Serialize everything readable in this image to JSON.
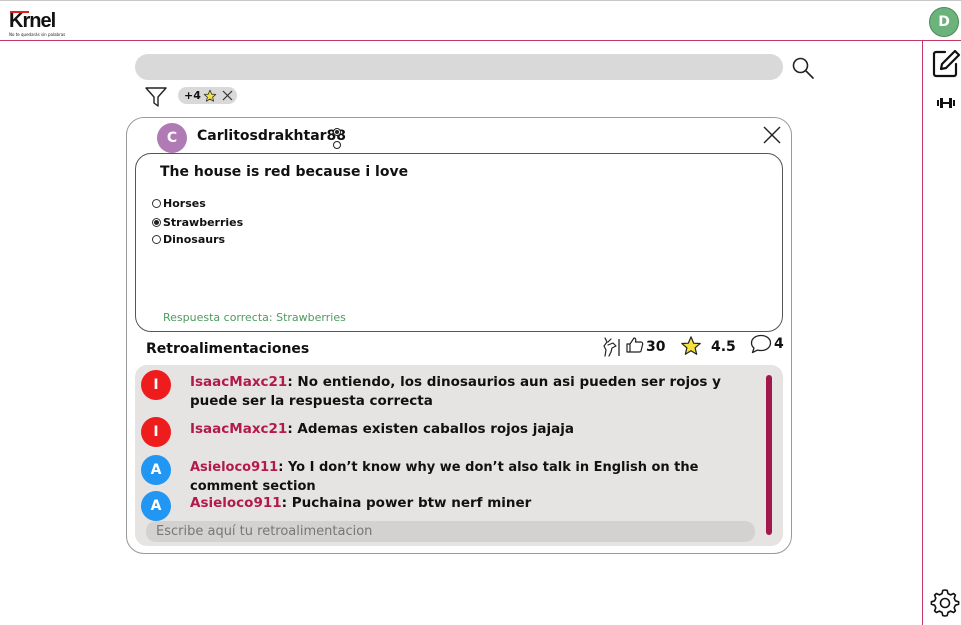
{
  "app": {
    "logo": "Krnel",
    "tagline": "No te quedarás sin palabras",
    "user_initial": "D"
  },
  "search": {
    "placeholder": "",
    "value": ""
  },
  "filter": {
    "chip_label": "+4",
    "chip_icon": "star-icon",
    "chip_remove_icon": "close-icon"
  },
  "post": {
    "author_initial": "C",
    "author": "Carlitosdrakhtar88",
    "question": "The house is red because i love",
    "options": [
      {
        "label": "Horses",
        "selected": false
      },
      {
        "label": "Strawberries",
        "selected": true
      },
      {
        "label": "Dinosaurs",
        "selected": false
      }
    ],
    "answer_text": "Respuesta correcta: Strawberries",
    "feedback_title": "Retroalimentaciones",
    "likes": "30",
    "rating": "4.5",
    "comments_count": "4"
  },
  "comments": [
    {
      "initial": "I",
      "user": "IsaacMaxc21",
      "text": ": No entiendo, los dinosaurios aun asi pueden ser rojos y puede ser la respuesta correcta",
      "color": "#ee1c1c"
    },
    {
      "initial": "I",
      "user": "IsaacMaxc21",
      "text": ": Ademas existen caballos rojos jajaja",
      "color": "#ee1c1c"
    },
    {
      "initial": "A",
      "user": "Asieloco911",
      "text": ": Yo I don’t know why we don’t also talk in English on the comment section",
      "color": "#2196f3"
    },
    {
      "initial": "A",
      "user": "Asieloco911",
      "text": ": Puchaina power btw nerf miner",
      "color": "#2196f3"
    }
  ],
  "reply": {
    "placeholder": "Escribe aquí tu retroalimentacion"
  },
  "colors": {
    "accent": "#c23a63",
    "user_name": "#b21a4e",
    "correct": "#4e9a60",
    "panel": "#e6e3e3"
  }
}
